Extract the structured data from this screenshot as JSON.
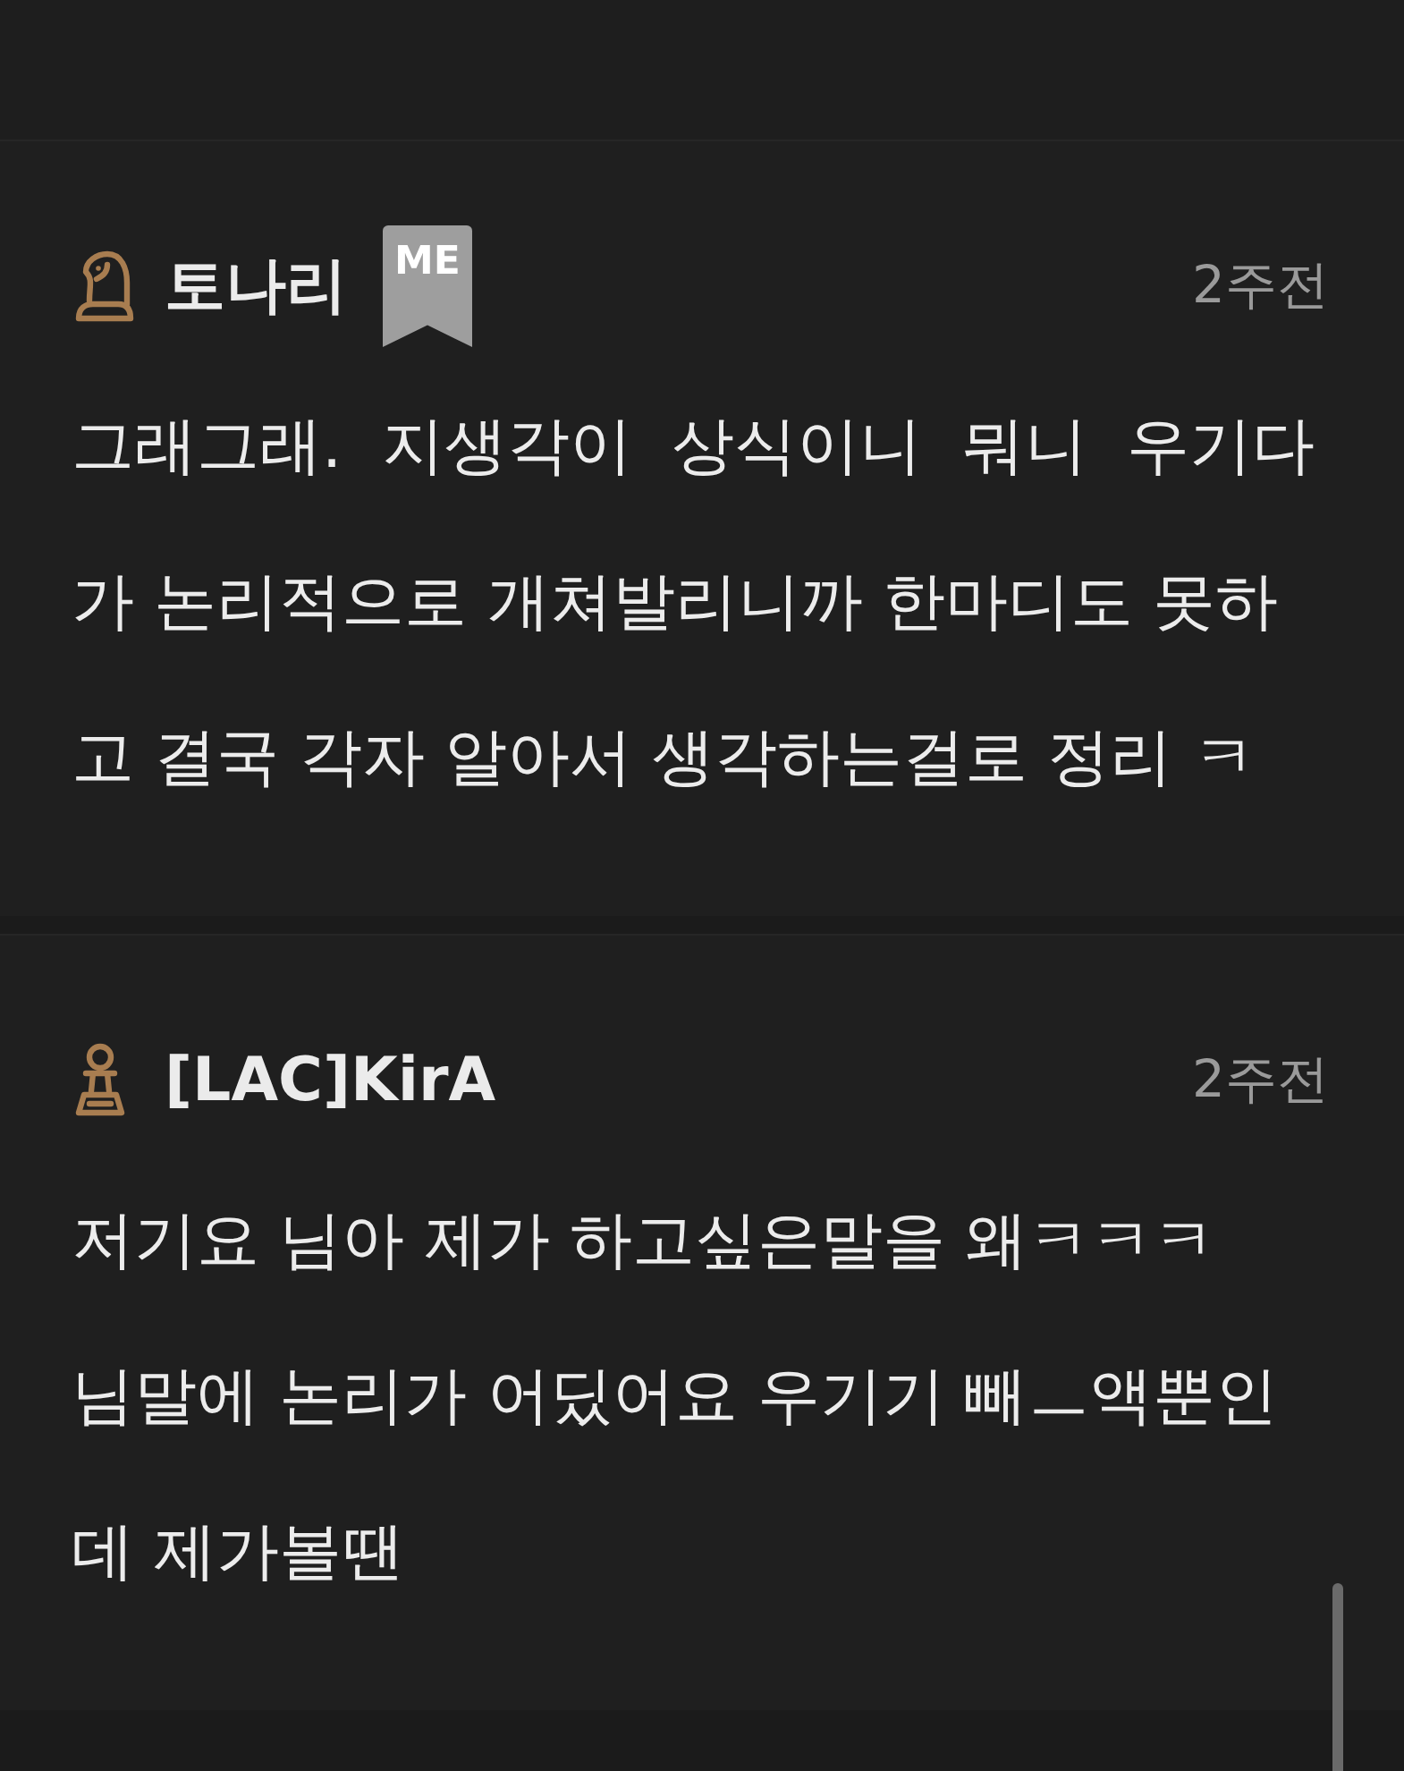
{
  "comments": [
    {
      "author": "토나리",
      "rank_icon": {
        "kind": "knight"
      },
      "me_badge": {
        "label": "ME"
      },
      "time": "2주전",
      "body": "그래그래.  지생각이  상식이니  뭐니  우기다가 논리적으로 개쳐발리니까 한마디도 못하고 결국 각자 알아서 생각하는걸로 정리 ㅋ"
    },
    {
      "author": "[LAC]KirA",
      "rank_icon": {
        "kind": "pawn"
      },
      "time": "2주전",
      "body": "저기요 님아 제가 하고싶은말을 왜ㅋㅋㅋ\n님말에 논리가 어딨어요 우기기 빼ㅡ액뿐인데 제가볼땐"
    }
  ]
}
